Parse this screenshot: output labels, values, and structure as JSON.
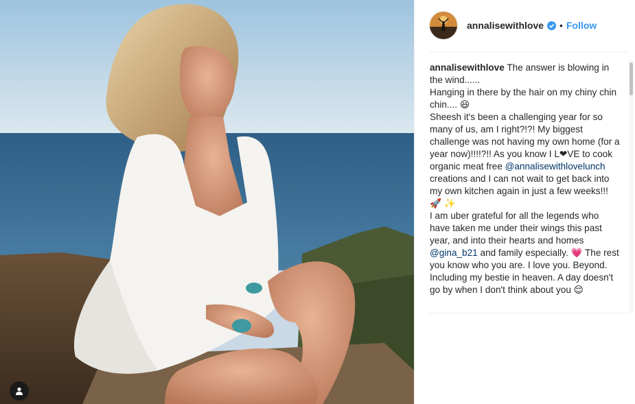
{
  "post": {
    "username": "annalisewithlove",
    "follow_label": "Follow",
    "separator": "•",
    "verified": true
  },
  "caption": {
    "author": "annalisewithlove",
    "lines": [
      " The answer is blowing in the wind...... ",
      "Hanging in there by the hair on my chiny chin chin.... 😆",
      "Sheesh it's been a challenging year for so many of us, am I right?!?! My biggest challenge was not having my own home (for a year now)!!!!?!! As you know I L❤VE to cook organic meat free ",
      "@annalisewithlovelunch",
      " creations and I can not wait to get back into my own kitchen again in just a few weeks!!! 🚀 ✨ ",
      "I am uber grateful for all the legends who have taken me under their wings this past year, and into their hearts and homes ",
      "@gina_b21",
      " and family especially. ",
      "💗 The rest you know who you are. I love you. Beyond. Including my bestie in heaven. A day doesn't go by when I don't think about you 😌"
    ]
  },
  "colors": {
    "accent": "#3897f0",
    "mention": "#003569",
    "verified": "#3897f0"
  },
  "icons": {
    "tag": "user-tag-icon",
    "verified": "verified-badge-icon"
  }
}
